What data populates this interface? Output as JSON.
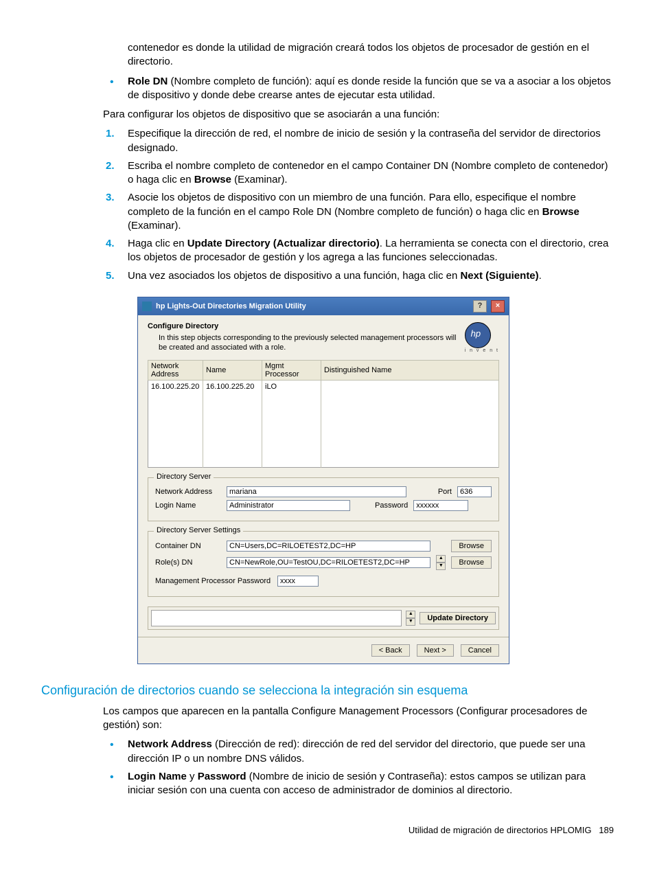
{
  "para_intro1_a": "contenedor es donde la utilidad de migración creará todos los objetos de procesador de gestión en el directorio.",
  "bullet_roleDN_bold": "Role DN",
  "bullet_roleDN_text": " (Nombre completo de función): aquí es donde reside la función que se va a asociar a los objetos de dispositivo y donde debe crearse antes de ejecutar esta utilidad.",
  "para_config_intro": "Para configurar los objetos de dispositivo que se asociarán a una función:",
  "steps": {
    "s1": "Especifique la dirección de red, el nombre de inicio de sesión y la contraseña del servidor de directorios designado.",
    "s2_a": "Escriba el nombre completo de contenedor en el campo Container DN (Nombre completo de contenedor) o haga clic en ",
    "s2_b_bold": "Browse",
    "s2_c": " (Examinar).",
    "s3_a": "Asocie los objetos de dispositivo con un miembro de una función. Para ello, especifique el nombre completo de la función en el campo Role DN (Nombre completo de función) o haga clic en ",
    "s3_b_bold": "Browse",
    "s3_c": " (Examinar).",
    "s4_a": "Haga clic en ",
    "s4_b_bold": "Update Directory (Actualizar directorio)",
    "s4_c": ". La herramienta se conecta con el directorio, crea los objetos de procesador de gestión y los agrega a las funciones seleccionadas.",
    "s5_a": "Una vez asociados los objetos de dispositivo a una función, haga clic en ",
    "s5_b_bold": "Next (Siguiente)",
    "s5_c": "."
  },
  "nums": {
    "n1": "1.",
    "n2": "2.",
    "n3": "3.",
    "n4": "4.",
    "n5": "5."
  },
  "dialog": {
    "title": "hp Lights-Out Directories Migration Utility",
    "help_icon": "?",
    "close_icon": "×",
    "heading": "Configure Directory",
    "description": "In this step objects corresponding to the previously selected management processors will be created and associated with a role.",
    "logo_sub": "i n v e n t",
    "columns": {
      "c1": "Network Address",
      "c2": "Name",
      "c3": "Mgmt Processor",
      "c4": "Distinguished Name"
    },
    "row1": {
      "addr": "16.100.225.20",
      "name": "16.100.225.20",
      "proc": "iLO",
      "dn": ""
    },
    "group_ds": "Directory Server",
    "ds_addr_label": "Network Address",
    "ds_addr_value": "mariana",
    "ds_port_label": "Port",
    "ds_port_value": "636",
    "ds_login_label": "Login Name",
    "ds_login_value": "Administrator",
    "ds_pass_label": "Password",
    "ds_pass_value": "xxxxxx",
    "group_dss": "Directory Server Settings",
    "container_label": "Container DN",
    "container_value": "CN=Users,DC=RILOETEST2,DC=HP",
    "roles_label": "Role(s) DN",
    "roles_value": "CN=NewRole,OU=TestOU,DC=RILOETEST2,DC=HP",
    "browse_label": "Browse",
    "mpp_label": "Management Processor Password",
    "mpp_value": "xxxx",
    "update_label": "Update Directory",
    "back_label": "< Back",
    "next_label": "Next >",
    "cancel_label": "Cancel",
    "spin_up": "▲",
    "spin_down": "▼"
  },
  "section2_head": "Configuración de directorios cuando se selecciona la integración sin esquema",
  "section2_intro": "Los campos que aparecen en la pantalla Configure Management Processors (Configurar procesadores de gestión) son:",
  "bullet2_a_bold": "Network Address",
  "bullet2_a_text": " (Dirección de red): dirección de red del servidor del directorio, que puede ser una dirección IP o un nombre DNS válidos.",
  "bullet2_b_bold1": "Login Name",
  "bullet2_b_mid": " y ",
  "bullet2_b_bold2": "Password",
  "bullet2_b_text": " (Nombre de inicio de sesión y Contraseña): estos campos se utilizan para iniciar sesión con una cuenta con acceso de administrador de dominios al directorio.",
  "footer_text": "Utilidad de migración de directorios HPLOMIG",
  "footer_page": "189"
}
